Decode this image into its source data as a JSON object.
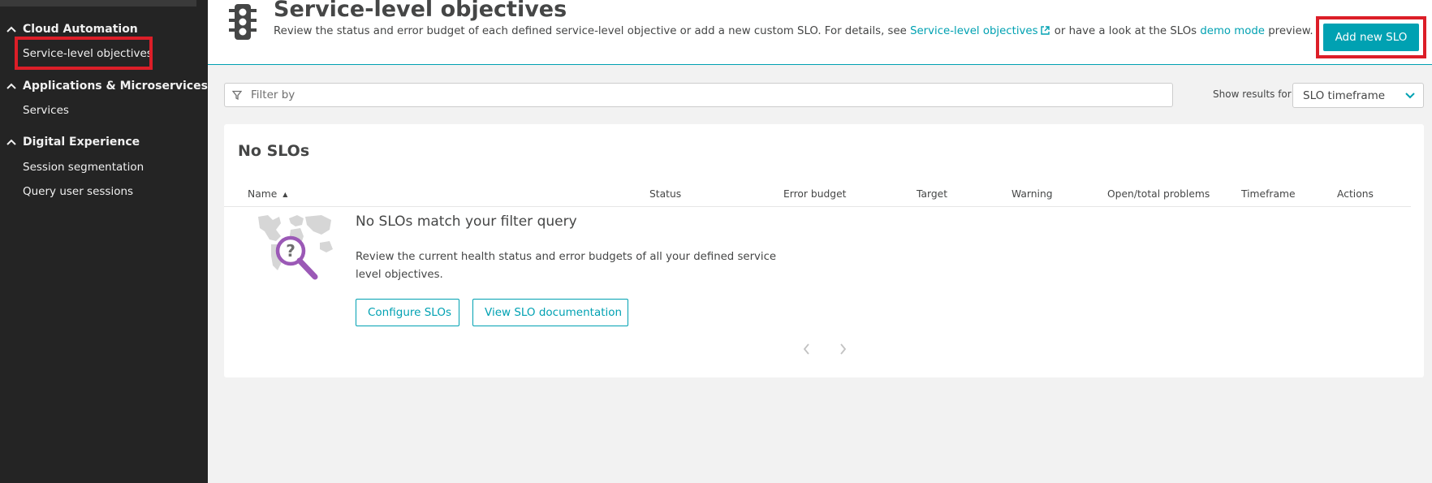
{
  "sidebar": {
    "groups": [
      {
        "label": "Cloud Automation",
        "items": [
          "Service-level objectives"
        ]
      },
      {
        "label": "Applications & Microservices",
        "items": [
          "Services"
        ]
      },
      {
        "label": "Digital Experience",
        "items": [
          "Session segmentation",
          "Query user sessions"
        ]
      }
    ]
  },
  "header": {
    "title": "Service-level objectives",
    "desc_prefix": "Review the status and error budget of each defined service-level objective or add a new custom SLO. For details, see",
    "desc_link1": "Service-level objectives",
    "desc_middle": "or have a look at the SLOs",
    "desc_link2": "demo mode",
    "desc_suffix": "preview.",
    "add_button": "Add new SLO"
  },
  "filter": {
    "placeholder": "Filter by",
    "show_results_label": "Show results for",
    "timeframe_value": "SLO timeframe"
  },
  "card": {
    "title": "No SLOs",
    "columns": [
      "Name",
      "Status",
      "Error budget",
      "Target",
      "Warning",
      "Open/total problems",
      "Timeframe",
      "Actions"
    ],
    "empty_title": "No SLOs match your filter query",
    "empty_desc": "Review the current health status and error budgets of all your defined service level objectives.",
    "configure_button": "Configure SLOs",
    "docs_button": "View SLO documentation"
  },
  "colors": {
    "accent": "#00a1b2",
    "highlight": "#dc1e28",
    "sidebar_bg": "#242424"
  },
  "icons": {
    "header": "traffic-light-icon",
    "empty_state": "world-map-magnifier-icon"
  }
}
